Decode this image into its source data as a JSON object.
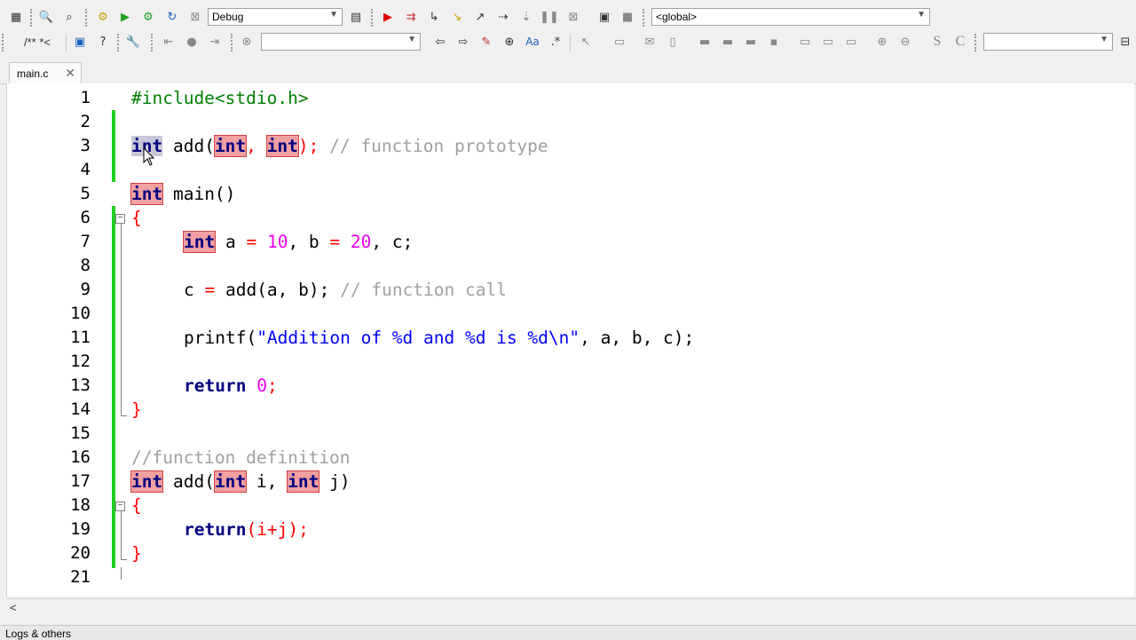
{
  "toolbar1": {
    "build_target": "Debug",
    "scope": "<global>"
  },
  "toolbar2": {
    "comment_label": "/** *<",
    "search_value": "",
    "right_search_value": ""
  },
  "tabs": [
    {
      "label": "main.c",
      "active": true
    }
  ],
  "editor": {
    "lines": [
      {
        "n": "1"
      },
      {
        "n": "2"
      },
      {
        "n": "3"
      },
      {
        "n": "4"
      },
      {
        "n": "5"
      },
      {
        "n": "6"
      },
      {
        "n": "7"
      },
      {
        "n": "8"
      },
      {
        "n": "9"
      },
      {
        "n": "10"
      },
      {
        "n": "11"
      },
      {
        "n": "12"
      },
      {
        "n": "13"
      },
      {
        "n": "14"
      },
      {
        "n": "15"
      },
      {
        "n": "16"
      },
      {
        "n": "17"
      },
      {
        "n": "18"
      },
      {
        "n": "19"
      },
      {
        "n": "20"
      },
      {
        "n": "21"
      }
    ],
    "code": {
      "l1": "#include<stdio.h>",
      "l3_kw": "int",
      "l3_fn": " add(",
      "l3_kw2": "int",
      "l3_sep": ", ",
      "l3_kw3": "int",
      "l3_end": ");",
      "l3_comment": " // function prototype",
      "l5_kw": "int",
      "l5_rest": " main()",
      "l6": "{",
      "l7_kw": "int",
      "l7_a": " a ",
      "l7_eq1": "=",
      "l7_n1": " 10",
      "l7_b": ", b ",
      "l7_eq2": "=",
      "l7_n2": " 20",
      "l7_c": ", c;",
      "l9_c": "c ",
      "l9_eq": "=",
      "l9_call": " add(a, b);",
      "l9_comment": " // function call",
      "l11_fn": "printf(",
      "l11_str": "\"Addition of %d and %d is %d\\n\"",
      "l11_rest": ", a, b, c);",
      "l13_kw": "return",
      "l13_n": " 0",
      "l13_end": ";",
      "l14": "}",
      "l16": "//function definition",
      "l17_kw": "int",
      "l17_fn": " add(",
      "l17_kw2": "int",
      "l17_i": " i, ",
      "l17_kw3": "int",
      "l17_j": " j)",
      "l18": "{",
      "l19_kw": "return",
      "l19_rest": "(i+j);",
      "l20": "}"
    }
  },
  "statusbar": {
    "logs_label": "Logs & others"
  },
  "colors": {
    "keyword_highlight": "#f2a0a0",
    "keyword_text": "#000080",
    "comment": "#a0a0a0",
    "number": "#f000f0",
    "string": "#0000ff",
    "change_bar": "#20d020"
  }
}
